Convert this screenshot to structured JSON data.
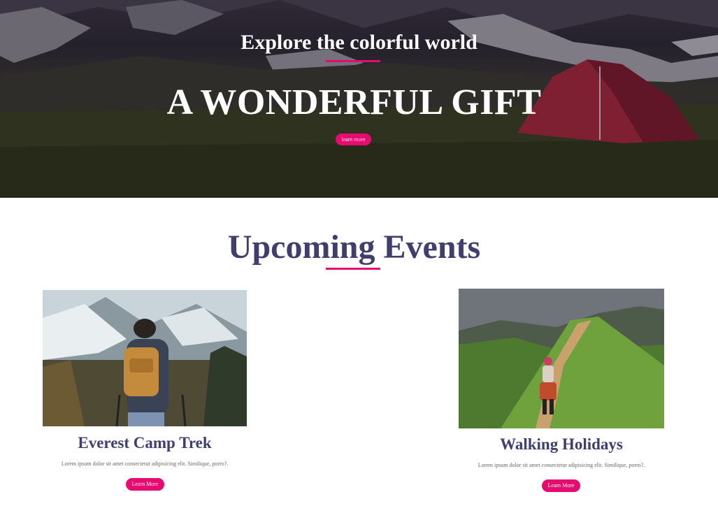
{
  "hero": {
    "subtitle": "Explore the colorful world",
    "title": "A WONDERFUL GIFT",
    "button_label": "learn more",
    "accent": "#e60b6f"
  },
  "events": {
    "heading": "Upcoming Events",
    "heading_color": "#3f3e6e",
    "cards": [
      {
        "title": "Everest Camp Trek",
        "text": "Lorem ipsum dolor sit amet consectetur adipisicing elit. Similique, porro?.",
        "button_label": "Learn More",
        "image": "hiker-backpack-mountains-photo"
      },
      {
        "title": "Walking Holidays",
        "text": "Lorem ipsum dolor sit amet consectetur adipisicing elit. Similique, porro?.",
        "button_label": "Learn More",
        "image": "trail-green-ridge-photo"
      }
    ]
  }
}
